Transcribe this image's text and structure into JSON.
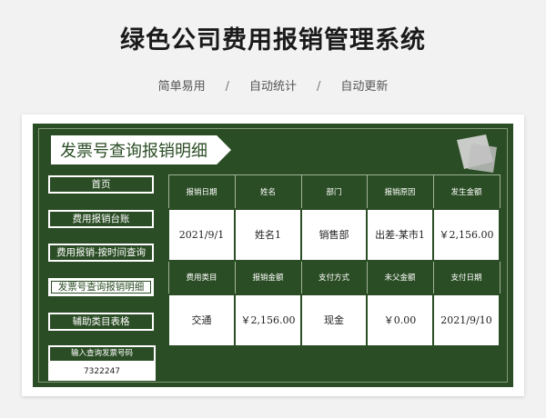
{
  "page": {
    "title": "绿色公司费用报销管理系统",
    "subtitle": [
      "简单易用",
      "自动统计",
      "自动更新"
    ],
    "separator": "/"
  },
  "app": {
    "banner": "发票号查询报销明细"
  },
  "nav": [
    {
      "label": "首页",
      "active": false
    },
    {
      "label": "费用报销台账",
      "active": false
    },
    {
      "label": "费用报销-按时间查询",
      "active": false
    },
    {
      "label": "发票号查询报销明细",
      "active": true
    },
    {
      "label": "辅助类目表格",
      "active": false
    }
  ],
  "invoice": {
    "label": "输入查询发票号码",
    "value": "7322247"
  },
  "table": {
    "row1_headers": [
      "报销日期",
      "姓名",
      "部门",
      "报销原因",
      "发生金额"
    ],
    "row1_values": [
      "2021/9/1",
      "姓名1",
      "销售部",
      "出差-某市1",
      "￥2,156.00"
    ],
    "row2_headers": [
      "费用类目",
      "报销金额",
      "支付方式",
      "未父金额",
      "支付日期"
    ],
    "row2_values": [
      "交通",
      "￥2,156.00",
      "现金",
      "￥0.00",
      "2021/9/10"
    ]
  },
  "colors": {
    "primary_green": "#2b4d25",
    "white": "#ffffff"
  }
}
